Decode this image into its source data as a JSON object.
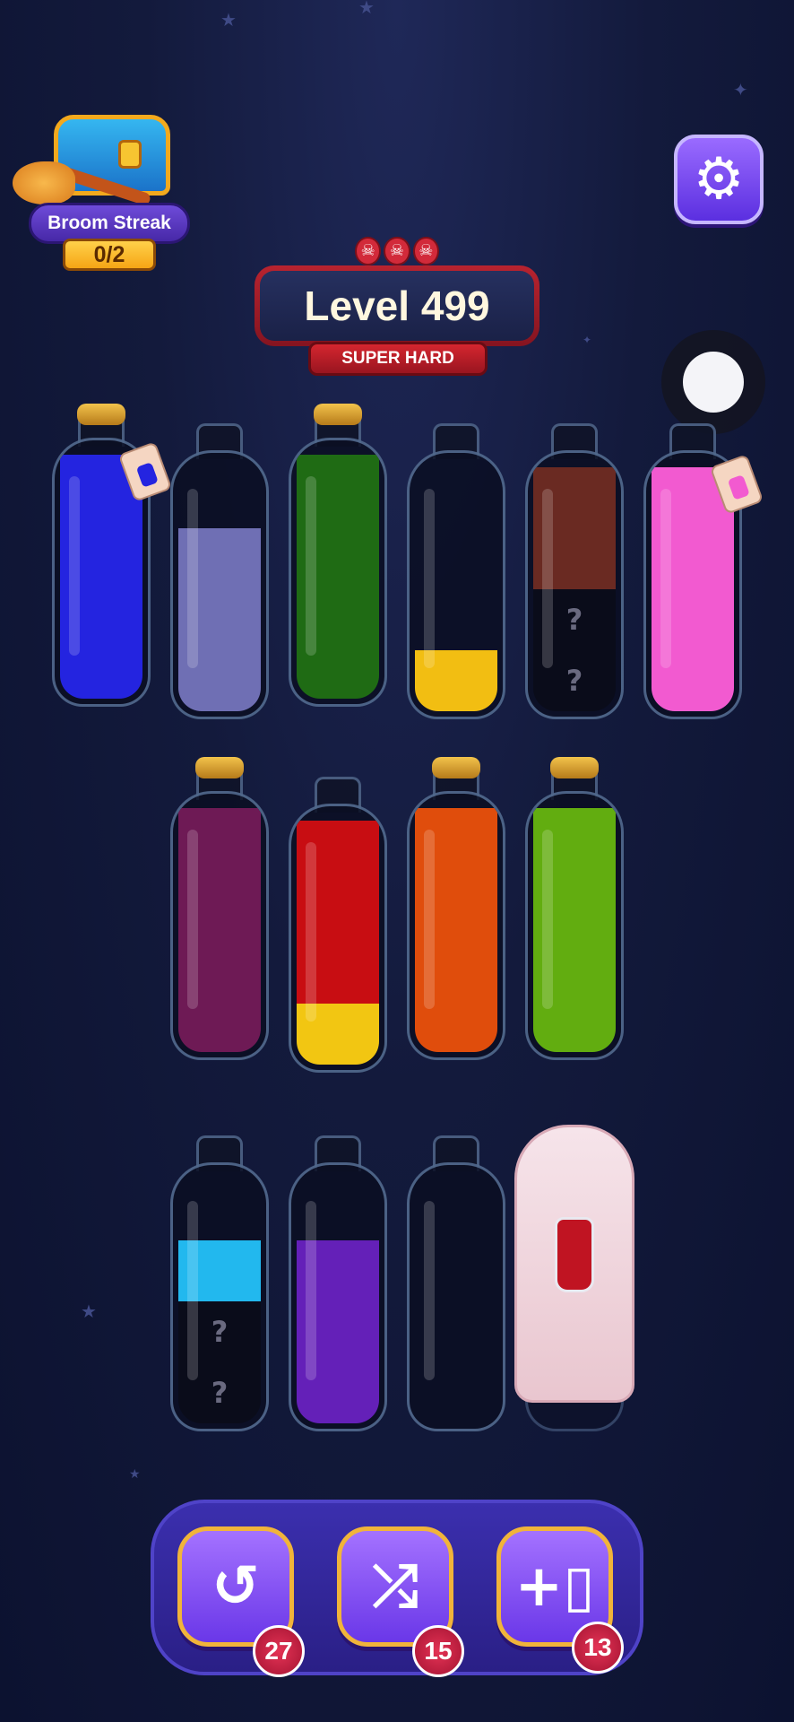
{
  "streak": {
    "label": "Broom Streak",
    "count": "0/2"
  },
  "settings": {
    "icon": "gear-icon"
  },
  "level": {
    "title": "Level 499",
    "difficulty": "SUPER HARD",
    "skull_count": 3
  },
  "bottles": [
    {
      "id": 1,
      "corked": true,
      "tag": true,
      "layers": [
        "#2424e0",
        "#2424e0",
        "#2424e0",
        "#2424e0"
      ]
    },
    {
      "id": 2,
      "corked": false,
      "layers": [
        "#6f6fb4",
        "#6f6fb4",
        "#6f6fb4"
      ]
    },
    {
      "id": 3,
      "corked": true,
      "layers": [
        "#1f6b14",
        "#1f6b14",
        "#1f6b14",
        "#1f6b14"
      ]
    },
    {
      "id": 4,
      "corked": false,
      "layers": [
        "#f2be12"
      ]
    },
    {
      "id": 5,
      "corked": false,
      "layers": [
        "hidden",
        "hidden",
        "#6a2a22",
        "#6a2a22"
      ],
      "hidden_mark": "?"
    },
    {
      "id": 6,
      "corked": false,
      "tag": true,
      "layers": [
        "#f25ad0",
        "#f25ad0",
        "#f25ad0",
        "#f25ad0"
      ]
    },
    {
      "id": 7,
      "corked": true,
      "layers": [
        "#6e1a55",
        "#6e1a55",
        "#6e1a55",
        "#6e1a55"
      ]
    },
    {
      "id": 8,
      "corked": false,
      "layers": [
        "#f2c612",
        "#c80d12",
        "#c80d12",
        "#c80d12"
      ]
    },
    {
      "id": 9,
      "corked": true,
      "layers": [
        "#e04d0c",
        "#e04d0c",
        "#e04d0c",
        "#e04d0c"
      ]
    },
    {
      "id": 10,
      "corked": true,
      "layers": [
        "#62ad10",
        "#62ad10",
        "#62ad10",
        "#62ad10"
      ]
    },
    {
      "id": 11,
      "corked": false,
      "layers": [
        "hidden",
        "hidden",
        "#22b8ee"
      ],
      "hidden_mark": "?"
    },
    {
      "id": 12,
      "corked": false,
      "layers": [
        "#6420b8",
        "#6420b8",
        "#6420b8"
      ]
    },
    {
      "id": 13,
      "corked": false,
      "layers": []
    },
    {
      "id": 14,
      "corked": false,
      "covered": true,
      "layers": []
    }
  ],
  "tools": [
    {
      "name": "undo",
      "icon": "undo-icon",
      "glyph": "↺",
      "count": "27"
    },
    {
      "name": "shuffle",
      "icon": "shuffle-icon",
      "glyph": "⤮",
      "count": "15"
    },
    {
      "name": "add-bottle",
      "icon": "add-bottle-icon",
      "glyph": "+▯",
      "count": "13"
    }
  ]
}
